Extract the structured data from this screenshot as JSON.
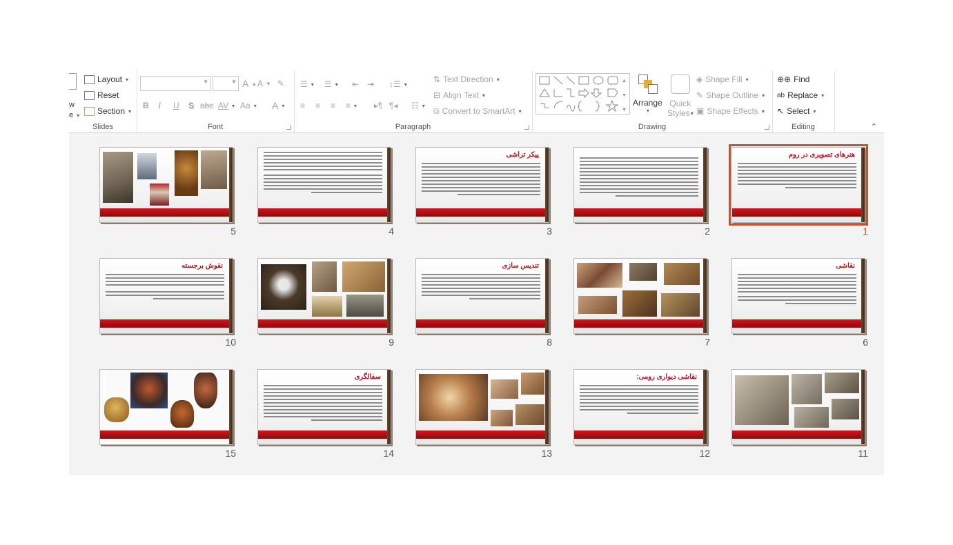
{
  "ribbon": {
    "slides": {
      "label": "Slides",
      "partial_top": "w",
      "partial_bottom": "e",
      "layout": "Layout",
      "reset": "Reset",
      "section": "Section"
    },
    "font": {
      "label": "Font",
      "font_name_value": "",
      "font_size_value": "",
      "bold": "B",
      "italic": "I",
      "underline": "U",
      "shadow": "S",
      "strike": "abc",
      "spacing": "AV",
      "case": "Aa",
      "color": "A",
      "grow": "A",
      "shrink": "A"
    },
    "paragraph": {
      "label": "Paragraph",
      "text_direction": "Text Direction",
      "align_text": "Align Text",
      "convert_smartart": "Convert to SmartArt"
    },
    "drawing": {
      "label": "Drawing",
      "arrange": "Arrange",
      "quick": "Quick",
      "styles": "Styles",
      "shape_fill": "Shape Fill",
      "shape_outline": "Shape Outline",
      "shape_effects": "Shape Effects"
    },
    "editing": {
      "label": "Editing",
      "find": "Find",
      "replace": "Replace",
      "select": "Select"
    }
  },
  "slides": [
    {
      "number": "1",
      "title": "هنرهای تصویری در روم",
      "selected": true
    },
    {
      "number": "2",
      "title": ""
    },
    {
      "number": "3",
      "title": "پیکر تراشی"
    },
    {
      "number": "4",
      "title": ""
    },
    {
      "number": "5",
      "title": ""
    },
    {
      "number": "6",
      "title": "نقاشی"
    },
    {
      "number": "7",
      "title": ""
    },
    {
      "number": "8",
      "title": "تندیس سازی"
    },
    {
      "number": "9",
      "title": ""
    },
    {
      "number": "10",
      "title": "نقوش برجسته"
    },
    {
      "number": "11",
      "title": ""
    },
    {
      "number": "12",
      "title": "نقاشی دیواری رومی:"
    },
    {
      "number": "13",
      "title": ""
    },
    {
      "number": "14",
      "title": "سفالگری"
    },
    {
      "number": "15",
      "title": ""
    }
  ],
  "colors": {
    "accent": "#c4532d",
    "slide_bar": "#c0121a",
    "title_red": "#b3141c"
  }
}
